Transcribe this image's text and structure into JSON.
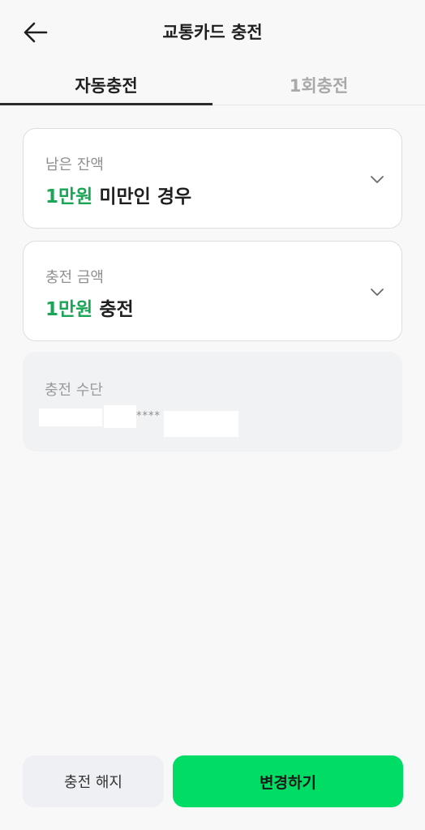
{
  "header": {
    "title": "교통카드 충전",
    "back_icon": "arrow-left-icon"
  },
  "tabs": [
    {
      "label": "자동충전",
      "active": true
    },
    {
      "label": "1회충전",
      "active": false
    }
  ],
  "balance_card": {
    "label": "남은 잔액",
    "value_accent": "1만원",
    "value_suffix": " 미만인 경우",
    "chevron_icon": "chevron-down-icon"
  },
  "amount_card": {
    "label": "충전 금액",
    "value_accent": "1만원",
    "value_suffix": " 충전",
    "chevron_icon": "chevron-down-icon"
  },
  "payment_card": {
    "label": "충전 수단",
    "masked_number": "****"
  },
  "buttons": {
    "cancel_label": "충전 해지",
    "change_label": "변경하기"
  },
  "colors": {
    "accent_text": "#1aa655",
    "primary_button": "#00dc64",
    "secondary_button": "#eef0f3",
    "background": "#f8f8f8"
  }
}
